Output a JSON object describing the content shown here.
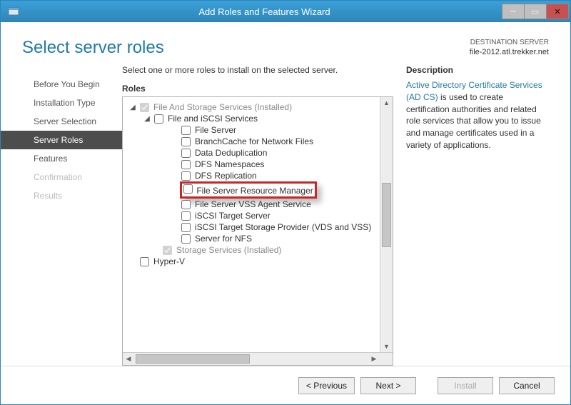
{
  "window": {
    "title": "Add Roles and Features Wizard"
  },
  "header": {
    "page_title": "Select server roles",
    "destination_label": "DESTINATION SERVER",
    "destination_server": "file-2012.atl.trekker.net"
  },
  "steps": [
    {
      "label": "Before You Begin",
      "state": "normal"
    },
    {
      "label": "Installation Type",
      "state": "normal"
    },
    {
      "label": "Server Selection",
      "state": "normal"
    },
    {
      "label": "Server Roles",
      "state": "active"
    },
    {
      "label": "Features",
      "state": "normal"
    },
    {
      "label": "Confirmation",
      "state": "disabled"
    },
    {
      "label": "Results",
      "state": "disabled"
    }
  ],
  "content": {
    "intro": "Select one or more roles to install on the selected server.",
    "roles_label": "Roles",
    "description_label": "Description",
    "description_link": "Active Directory Certificate Services (AD CS)",
    "description_rest": " is used to create certification authorities and related role services that allow you to issue and manage certificates used in a variety of applications."
  },
  "tree": {
    "root": "File And Storage Services (Installed)",
    "group": "File and iSCSI Services",
    "items": [
      "File Server",
      "BranchCache for Network Files",
      "Data Deduplication",
      "DFS Namespaces",
      "DFS Replication",
      "File Server Resource Manager",
      "File Server VSS Agent Service",
      "iSCSI Target Server",
      "iSCSI Target Storage Provider (VDS and VSS)",
      "Server for NFS"
    ],
    "storage": "Storage Services (Installed)",
    "hyperv": "Hyper-V"
  },
  "footer": {
    "prev": "< Previous",
    "next": "Next >",
    "install": "Install",
    "cancel": "Cancel"
  }
}
